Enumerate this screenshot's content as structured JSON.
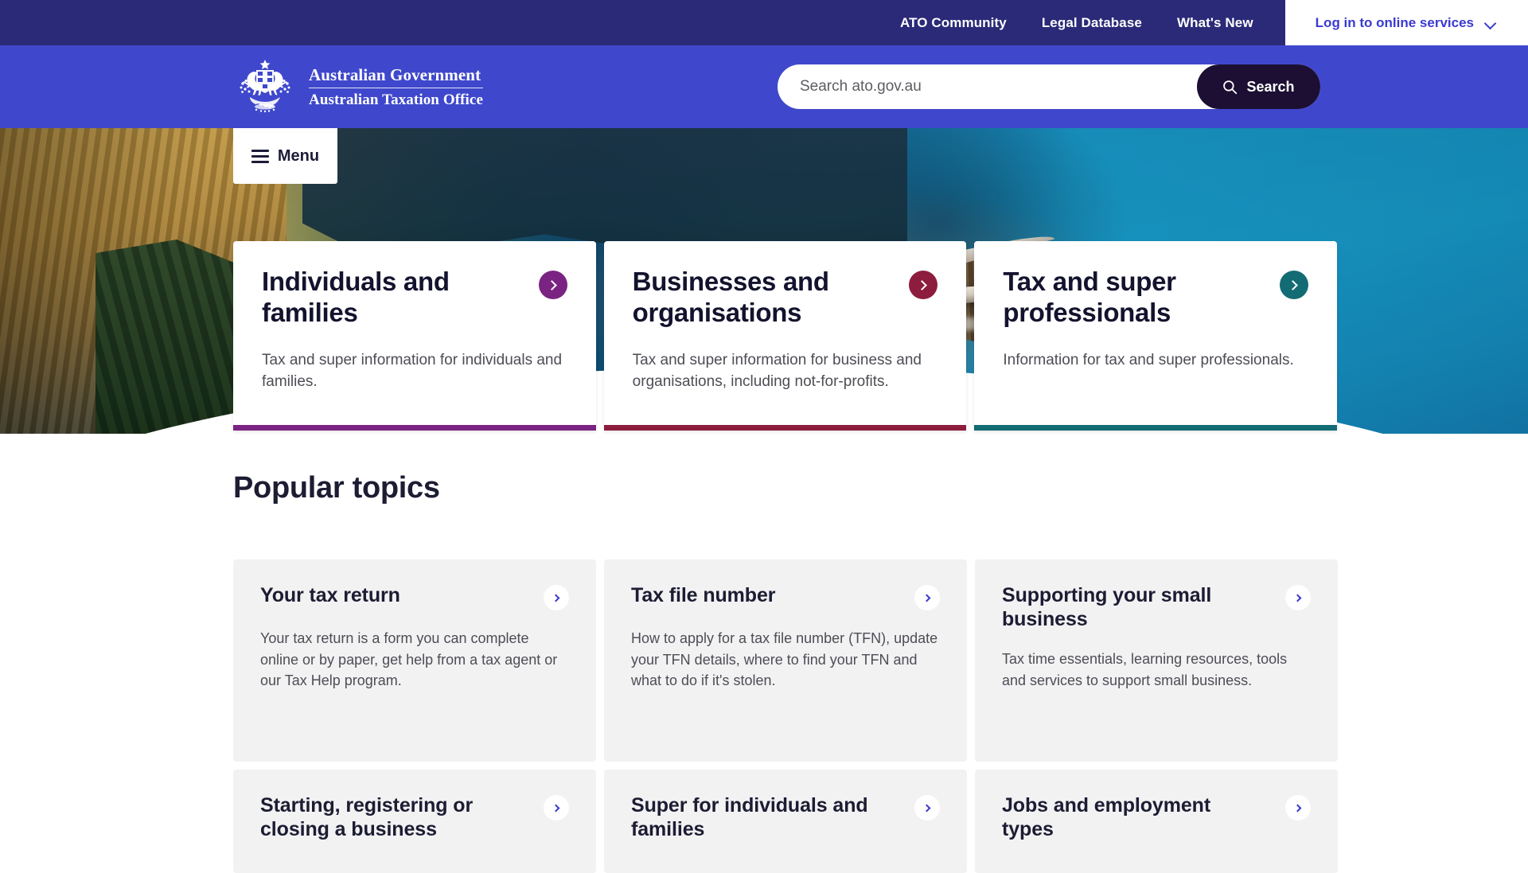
{
  "utility_nav": {
    "links": [
      {
        "label": "ATO Community",
        "icon": ""
      },
      {
        "label": "Legal Database",
        "icon": ""
      },
      {
        "label": "What's New",
        "icon": ""
      }
    ],
    "login": {
      "label": "Log in to online services",
      "icon": "chevron-down-icon"
    }
  },
  "masthead": {
    "brand": {
      "icon": "australian-coat-of-arms-icon",
      "line1": "Australian Government",
      "line2": "Australian Taxation Office"
    },
    "search": {
      "placeholder": "Search ato.gov.au",
      "value": "",
      "button_label": "Search",
      "button_icon": "search-icon"
    }
  },
  "hero": {
    "menu_button": {
      "label": "Menu",
      "icon": "hamburger-icon"
    },
    "cards": [
      {
        "title": "Individuals and families",
        "desc": "Tax and super information for individuals and families.",
        "accent": "#7b2382",
        "accent_name": "purple",
        "arrow_icon": "chevron-right-icon"
      },
      {
        "title": "Businesses and organisations",
        "desc": "Tax and super information for business and organisations, including not-for-profits.",
        "accent": "#8c1d3f",
        "accent_name": "maroon",
        "arrow_icon": "chevron-right-icon"
      },
      {
        "title": "Tax and super professionals",
        "desc": "Information for tax and super professionals.",
        "accent": "#136b74",
        "accent_name": "teal",
        "arrow_icon": "chevron-right-icon"
      }
    ]
  },
  "popular_topics": {
    "heading": "Popular topics",
    "cards": [
      {
        "title": "Your tax return",
        "desc": "Your tax return is a form you can complete online or by paper, get help from a tax agent or our Tax Help program.",
        "arrow_icon": "chevron-right-icon"
      },
      {
        "title": "Tax file number",
        "desc": "How to apply for a tax file number (TFN), update your TFN details, where to find your TFN and what to do if it's stolen.",
        "arrow_icon": "chevron-right-icon"
      },
      {
        "title": "Supporting your small business",
        "desc": "Tax time essentials, learning resources, tools and services to support small business.",
        "arrow_icon": "chevron-right-icon"
      },
      {
        "title": "Starting, registering or closing a business",
        "desc": "",
        "arrow_icon": "chevron-right-icon"
      },
      {
        "title": "Super for individuals and families",
        "desc": "",
        "arrow_icon": "chevron-right-icon"
      },
      {
        "title": "Jobs and employment types",
        "desc": "",
        "arrow_icon": "chevron-right-icon"
      }
    ]
  },
  "colors": {
    "utility_bar_bg": "#2b2a78",
    "masthead_bg": "#3f48cc",
    "link_blue": "#3a3ad0",
    "search_button_bg": "#1c0f33",
    "card_bg": "#f2f2f3",
    "heading_text": "#1c1c33"
  }
}
